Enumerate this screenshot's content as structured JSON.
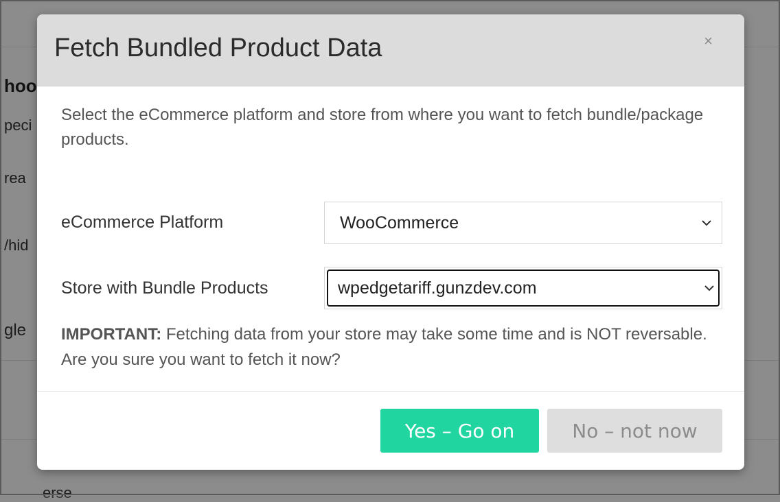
{
  "background": {
    "fragments": [
      "hoo",
      "peci",
      "rea",
      "/hid",
      "gle",
      "erse"
    ]
  },
  "modal": {
    "title": "Fetch Bundled Product Data",
    "close_icon": "×",
    "intro": "Select the eCommerce platform and store from where you want to fetch bundle/package products.",
    "platform": {
      "label": "eCommerce Platform",
      "value": "WooCommerce"
    },
    "store": {
      "label": "Store with Bundle Products",
      "value": "wpedgetariff.gunzdev.com"
    },
    "important_label": "IMPORTANT:",
    "important_text": " Fetching data from your store may take some time and is NOT reversable. Are you sure you want to fetch it now?",
    "yes_button": "Yes – Go on",
    "no_button": "No – not now"
  },
  "colors": {
    "accent": "#21d5a0",
    "header_bg": "#dcdcdc",
    "overlay": "rgba(0,0,0,0.45)"
  }
}
